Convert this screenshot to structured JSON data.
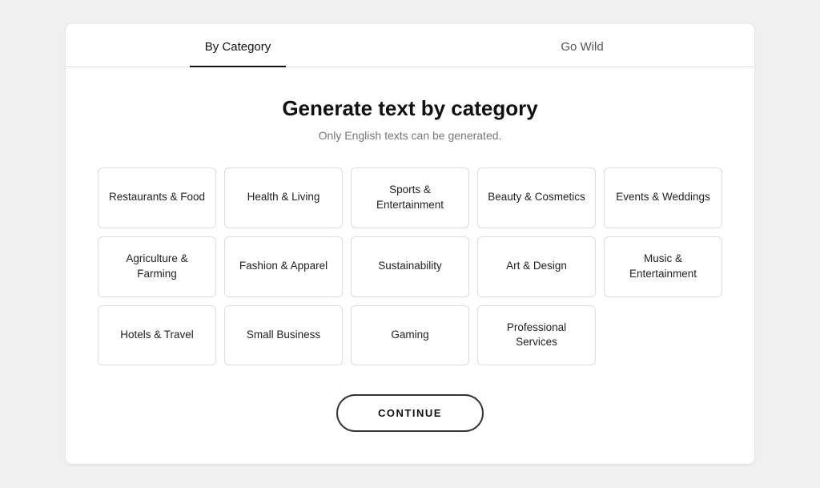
{
  "tabs": [
    {
      "id": "by-category",
      "label": "By Category",
      "active": true
    },
    {
      "id": "go-wild",
      "label": "Go Wild",
      "active": false
    }
  ],
  "heading": "Generate text by category",
  "subtitle": "Only English texts can be generated.",
  "categories": [
    "Restaurants & Food",
    "Health & Living",
    "Sports & Entertainment",
    "Beauty & Cosmetics",
    "Events & Weddings",
    "Agriculture & Farming",
    "Fashion & Apparel",
    "Sustainability",
    "Art & Design",
    "Music & Entertainment",
    "Hotels & Travel",
    "Small Business",
    "Gaming",
    "Professional Services"
  ],
  "continue_button": "CONTINUE"
}
